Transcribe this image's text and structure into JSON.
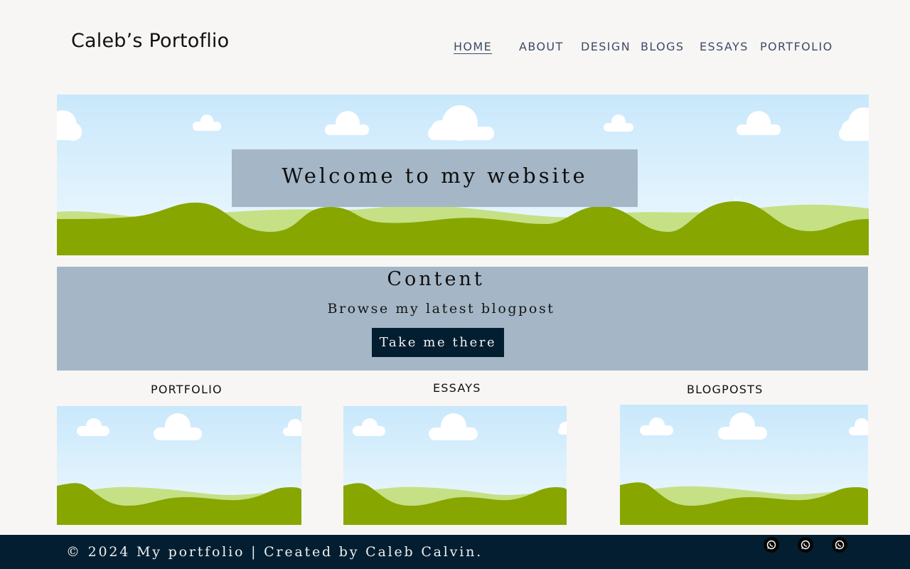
{
  "header": {
    "site_title": "Caleb’s Portoflio"
  },
  "nav": {
    "items": [
      {
        "label": "HOME",
        "active": true
      },
      {
        "label": "ABOUT"
      },
      {
        "label": "DESIGN"
      },
      {
        "label": "BLOGS"
      },
      {
        "label": "ESSAYS"
      },
      {
        "label": "PORTFOLIO"
      }
    ]
  },
  "hero": {
    "welcome": "Welcome to my website"
  },
  "content": {
    "title": "Content",
    "subtitle": "Browse my latest blogpost",
    "cta_label": "Take me there"
  },
  "cards": [
    {
      "label": "PORTFOLIO"
    },
    {
      "label": "ESSAYS"
    },
    {
      "label": "BLOGPOSTS"
    }
  ],
  "footer": {
    "text": "© 2024 My portfolio | Created by Caleb Calvin.",
    "social_icons": [
      "whatsapp-icon",
      "whatsapp-icon",
      "whatsapp-icon"
    ]
  },
  "colors": {
    "page_bg": "#f7f6f4",
    "panel": "#a5b7c7",
    "navy": "#031e30",
    "nav_text": "#3e4a66",
    "sky_top": "#c8e8fb",
    "hill_dark": "#87a600",
    "hill_light": "#c6e085"
  }
}
